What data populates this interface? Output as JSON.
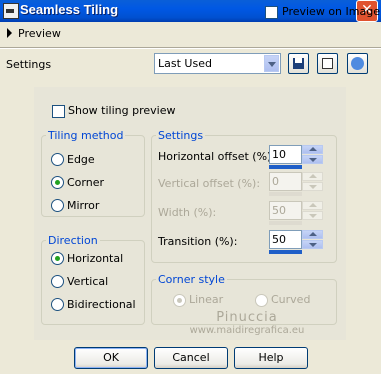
{
  "window": {
    "title": "Seamless Tiling"
  },
  "preview": {
    "toggle_label": "Preview",
    "on_image_label": "Preview on Image"
  },
  "settings_row": {
    "label": "Settings",
    "preset_value": "Last Used"
  },
  "show_tiling_preview": {
    "label": "Show tiling preview"
  },
  "tiling_method": {
    "legend": "Tiling method",
    "options": [
      "Edge",
      "Corner",
      "Mirror"
    ],
    "selected": "Corner"
  },
  "direction": {
    "legend": "Direction",
    "options": [
      "Horizontal",
      "Vertical",
      "Bidirectional"
    ],
    "selected": "Horizontal"
  },
  "settings_group": {
    "legend": "Settings",
    "horizontal_offset": {
      "label": "Horizontal offset (%):",
      "value": "10"
    },
    "vertical_offset": {
      "label": "Vertical offset (%):",
      "value": "0"
    },
    "width": {
      "label": "Width (%):",
      "value": "50"
    },
    "transition": {
      "label": "Transition (%):",
      "value": "50"
    }
  },
  "corner_style": {
    "legend": "Corner style",
    "options": [
      "Linear",
      "Curved"
    ],
    "selected": "Linear"
  },
  "watermark": {
    "line1": "Pinuccia",
    "line2": "www.maidiregrafica.eu"
  },
  "buttons": {
    "ok": "OK",
    "cancel": "Cancel",
    "help": "Help"
  },
  "icons": {
    "close": "close-icon",
    "save": "save-icon",
    "randomize": "dice-icon",
    "reset": "reset-icon"
  }
}
